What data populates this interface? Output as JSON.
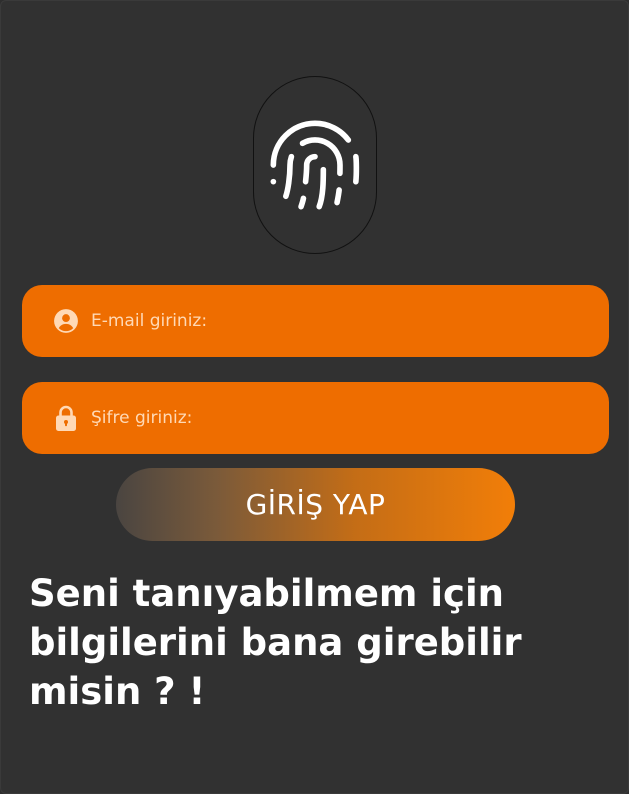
{
  "fingerprint": {
    "icon": "fingerprint-icon"
  },
  "form": {
    "email": {
      "icon": "user-circle-icon",
      "placeholder": "E-mail giriniz:"
    },
    "password": {
      "icon": "lock-icon",
      "placeholder": "Şifre giriniz:"
    },
    "submit_label": "GİRİŞ YAP"
  },
  "prompt_text": "Seni tanıyabilmem için bilgilerini bana girebilir misin ? !",
  "colors": {
    "background": "#313131",
    "accent": "#ee6d00",
    "text": "#ffffff"
  }
}
